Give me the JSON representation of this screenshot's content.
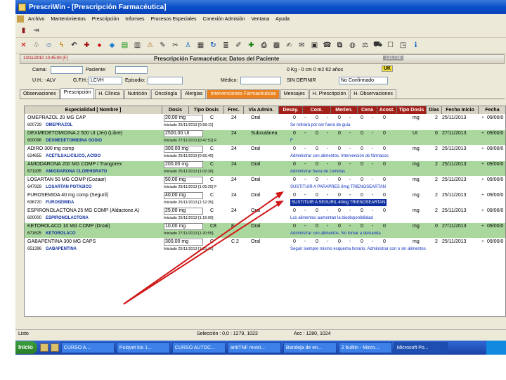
{
  "window": {
    "title": "PrescriWin - [Prescripción Farmacéutica]"
  },
  "menu": [
    "Archivo",
    "Mantenimientos",
    "Prescripción",
    "Informes",
    "Procesos Especiales",
    "Conexión Admisión",
    "Ventana",
    "Ayuda"
  ],
  "header": {
    "date_user": "13/11/2010 10:45:00 [F]",
    "title": "Prescripción Farmacéutica: Datos del Paciente",
    "nhc": "131730"
  },
  "patient": {
    "cama_label": "Cama:",
    "paciente_label": "Paciente:",
    "uhu_label": "U.H.: -ALV",
    "gfh_label": "G.F.H.:",
    "gfh_value": "LCVH",
    "episodio_label": "Episodio:",
    "medico_label": "Médico:",
    "weight_age": "0 Kg - 0 cm   0 m2   62 años",
    "sin_definir": "SIN DEFINIR",
    "estado": "No Confirmado",
    "uk": "UK"
  },
  "tabs": [
    "Observaciones",
    "Prescripción",
    "H. Clínica",
    "Nutrición",
    "Oncología",
    "Alergias",
    "Intervenciones Farmacéuticas",
    "Mensajes",
    "H. Prescripción",
    "H. Observaciones"
  ],
  "columns": [
    "Especialidad [ Nombre ]",
    "Dosis",
    "Tipo Dosis",
    "Frec.",
    "Vía Admin.",
    "Desay.",
    "Com.",
    "Merien.",
    "Cena",
    "Acost.",
    "Tipo Dosis",
    "Días",
    "Fecha Inicio",
    "Fecha"
  ],
  "rows": [
    {
      "name": "OMEPRAZOL 20 MG CAP",
      "code": "600729",
      "sub": "OMEPRAZOL",
      "dosis": "20,00 mg",
      "tipo": "C",
      "frec": "24",
      "via": "Oral",
      "doses": [
        "0",
        "-",
        "0",
        "-",
        "0",
        "-",
        "0",
        "-",
        "0"
      ],
      "tipo2": "mg",
      "dias": "2",
      "fecha": "25/11/2013",
      "fecha2": "09/00/0",
      "dates": "Iniciado 25/11/2013 [0:58:11]",
      "note": "Se retirará por ser fuera de guía",
      "bg": "white"
    },
    {
      "name": "DEXMEDETOMIDINA 2 500 UI (Jer) (Libre)",
      "code": "600098",
      "sub": "DEXMEDETOMIDINA SODIO",
      "dosis": "2500,00 UI",
      "tipo": "",
      "frec": "24",
      "via": "Subcutánea",
      "doses": [
        "0",
        "-",
        "0",
        "-",
        "0",
        "-",
        "0",
        "-",
        "0"
      ],
      "tipo2": "UI",
      "dias": "0",
      "fecha": "27/11/2013",
      "fecha2": "09/00/0",
      "dates": "Iniciado 27/11/2013 [0:47:52] F",
      "note": "F",
      "bg": "green"
    },
    {
      "name": "ADIRO 300 mg comp",
      "code": "624655",
      "sub": "ACETILSALICILICO, ACIDO",
      "dosis": "300,00 mg",
      "tipo": "C",
      "frec": "24",
      "via": "Oral",
      "doses": [
        "0",
        "-",
        "0",
        "-",
        "0",
        "-",
        "0",
        "-",
        "0"
      ],
      "tipo2": "mg",
      "dias": "2",
      "fecha": "25/11/2013",
      "fecha2": "09/00/0",
      "dates": "Iniciado 25/11/2013 [0:55:45]",
      "note": "Administrar con alimentos. Intervención de fármacos",
      "bg": "white"
    },
    {
      "name": "AMIODARONA 200 MG COMP / Trangorex",
      "code": "671935",
      "sub": "AMIODARONA CLORHIDRATO",
      "dosis": "200,00 mg",
      "tipo": "C",
      "frec": "24",
      "via": "Oral",
      "doses": [
        "0",
        "-",
        "0",
        "-",
        "0",
        "-",
        "0",
        "-",
        "0"
      ],
      "tipo2": "mg",
      "dias": "2",
      "fecha": "25/11/2013",
      "fecha2": "09/00/0",
      "dates": "Iniciado 25/11/2013 [1:02:30]",
      "note": "Administrar fuera de comidas",
      "bg": "green"
    },
    {
      "name": "LOSARTAN 50 MG COMP (Cozaar)",
      "code": "647929",
      "sub": "LOSARTAN POTASICO",
      "dosis": "50,00 mg",
      "tipo": "C",
      "frec": "24",
      "via": "Oral",
      "doses": [
        "0",
        "-",
        "0",
        "-",
        "0",
        "-",
        "0",
        "-",
        "0"
      ],
      "tipo2": "mg",
      "dias": "2",
      "fecha": "25/11/2013",
      "fecha2": "09/00/0",
      "dates": "Iniciado 25/11/2013 [1:05:25] F",
      "note": "SUSTITUIR A PARAPRES 8mg TRIENOSEARTAN",
      "bg": "white"
    },
    {
      "name": "FUROSEMIDA 40 mg comp (Seguril)",
      "code": "636720",
      "sub": "FUROSEMIDA",
      "dosis": "40,00 mg",
      "tipo": "C",
      "frec": "24",
      "via": "Oral",
      "doses": [
        "0",
        "-",
        "0",
        "-",
        "0",
        "-",
        "0",
        "-",
        "0"
      ],
      "tipo2": "mg",
      "dias": "2",
      "fecha": "25/11/2013",
      "fecha2": "09/00/0",
      "dates": "Iniciado 25/11/2013 [1:12:35]",
      "note": "SUSTITUIR A SEGURIL 40mg TRIENOSEARTAN",
      "bg": "white"
    },
    {
      "name": "ESPIRONOLACTONA 25 MG COMP (Aldactone A)",
      "code": "600000",
      "sub": "ESPIRONOLACTONA",
      "dosis": "25,00 mg",
      "tipo": "C",
      "frec": "24",
      "via": "Oral",
      "doses": [
        "0",
        "-",
        "0",
        "-",
        "0",
        "-",
        "0",
        "-",
        "0"
      ],
      "tipo2": "mg",
      "dias": "2",
      "fecha": "25/11/2013",
      "fecha2": "09/00/0",
      "dates": "Iniciado 25/11/2013 [1:15:00]",
      "note": "Los alimentos aumentan la biodisponibilidad",
      "bg": "white"
    },
    {
      "name": "KETOROLACO 10 MG COMP (Droal)",
      "code": "671625",
      "sub": "KETOROLACO",
      "dosis": "10,00 mg",
      "tipo": "C8",
      "frec": "8",
      "via": "Oral",
      "doses": [
        "0",
        "-",
        "0",
        "-",
        "0",
        "-",
        "0",
        "-",
        "0"
      ],
      "tipo2": "mg",
      "dias": "0",
      "fecha": "27/11/2013",
      "fecha2": "09/00/0",
      "dates": "Iniciado 27/11/2013 [1:20:55]",
      "note": "Administrar con alimentos. No tomar a demanda",
      "bg": "green"
    },
    {
      "name": "GABAPENTINA 300 MG CAPS",
      "code": "651396",
      "sub": "GABAPENTINA",
      "dosis": "300,00 mg",
      "tipo": "C",
      "frec": "C 2",
      "via": "Oral",
      "doses": [
        "0",
        "-",
        "0",
        "-",
        "0",
        "-",
        "0",
        "-",
        "0"
      ],
      "tipo2": "mg",
      "dias": "2",
      "fecha": "25/11/2013",
      "fecha2": "09/00/0",
      "dates": "Iniciado 25/11/2013 [1:25:40]",
      "note": "Seguir siempre mismo esquema horario. Administrar con o sin alimentos",
      "bg": "white"
    }
  ],
  "status": {
    "left": "Listo",
    "mid": "Selección : 0,0 : 1279, 1023",
    "right": "Acc : 1280, 1024"
  },
  "taskbar": {
    "start": "Inicio",
    "tasks": [
      "CURSO A...",
      "Pulqvet los 1...",
      "CURSO AUTOC...",
      "antiTNF revisi...",
      "Bandeja de en...",
      "2 bulltin - Micro...",
      "Microsoft Po...",
      ""
    ]
  }
}
